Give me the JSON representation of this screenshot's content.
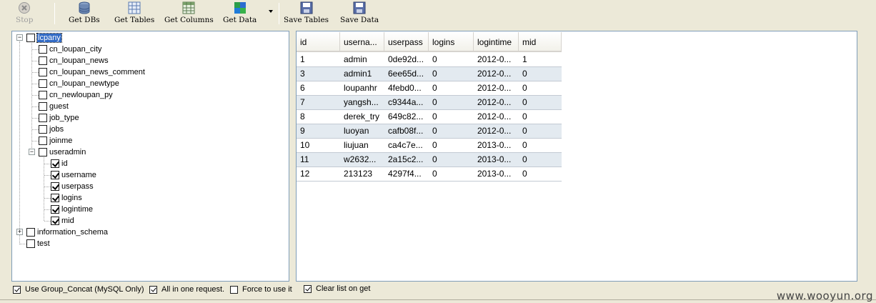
{
  "toolbar": {
    "stop": "Stop",
    "get_dbs": "Get DBs",
    "get_tables": "Get Tables",
    "get_columns": "Get Columns",
    "get_data": "Get Data",
    "save_tables": "Save Tables",
    "save_data": "Save Data"
  },
  "tree": {
    "root_label": "lcpany",
    "tables": {
      "t0": "cn_loupan_city",
      "t1": "cn_loupan_news",
      "t2": "cn_loupan_news_comment",
      "t3": "cn_loupan_newtype",
      "t4": "cn_newloupan_py",
      "t5": "guest",
      "t6": "job_type",
      "t7": "jobs",
      "t8": "joinme",
      "t9": "useradmin"
    },
    "columns": {
      "c0": "id",
      "c1": "username",
      "c2": "userpass",
      "c3": "logins",
      "c4": "logintime",
      "c5": "mid"
    },
    "db2": "information_schema",
    "db3": "test"
  },
  "grid": {
    "headers": [
      "id",
      "userna...",
      "userpass",
      "logins",
      "logintime",
      "mid"
    ],
    "rows": [
      [
        "1",
        "admin",
        "0de92d...",
        "0",
        "2012-0...",
        "1"
      ],
      [
        "3",
        "admin1",
        "6ee65d...",
        "0",
        "2012-0...",
        "0"
      ],
      [
        "6",
        "loupanhr",
        "4febd0...",
        "0",
        "2012-0...",
        "0"
      ],
      [
        "7",
        "yangsh...",
        "c9344a...",
        "0",
        "2012-0...",
        "0"
      ],
      [
        "8",
        "derek_try",
        "649c82...",
        "0",
        "2012-0...",
        "0"
      ],
      [
        "9",
        "luoyan",
        "cafb08f...",
        "0",
        "2012-0...",
        "0"
      ],
      [
        "10",
        "liujuan",
        "ca4c7e...",
        "0",
        "2013-0...",
        "0"
      ],
      [
        "11",
        "w2632...",
        "2a15c2...",
        "0",
        "2013-0...",
        "0"
      ],
      [
        "12",
        "213123",
        "4297f4...",
        "0",
        "2013-0...",
        "0"
      ]
    ]
  },
  "options": {
    "group_concat": "Use Group_Concat (MySQL Only)",
    "all_in_one": "All in one request.",
    "force": "Force to use it",
    "clear_list": "Clear list on get"
  },
  "watermark": "www.wooyun.org"
}
